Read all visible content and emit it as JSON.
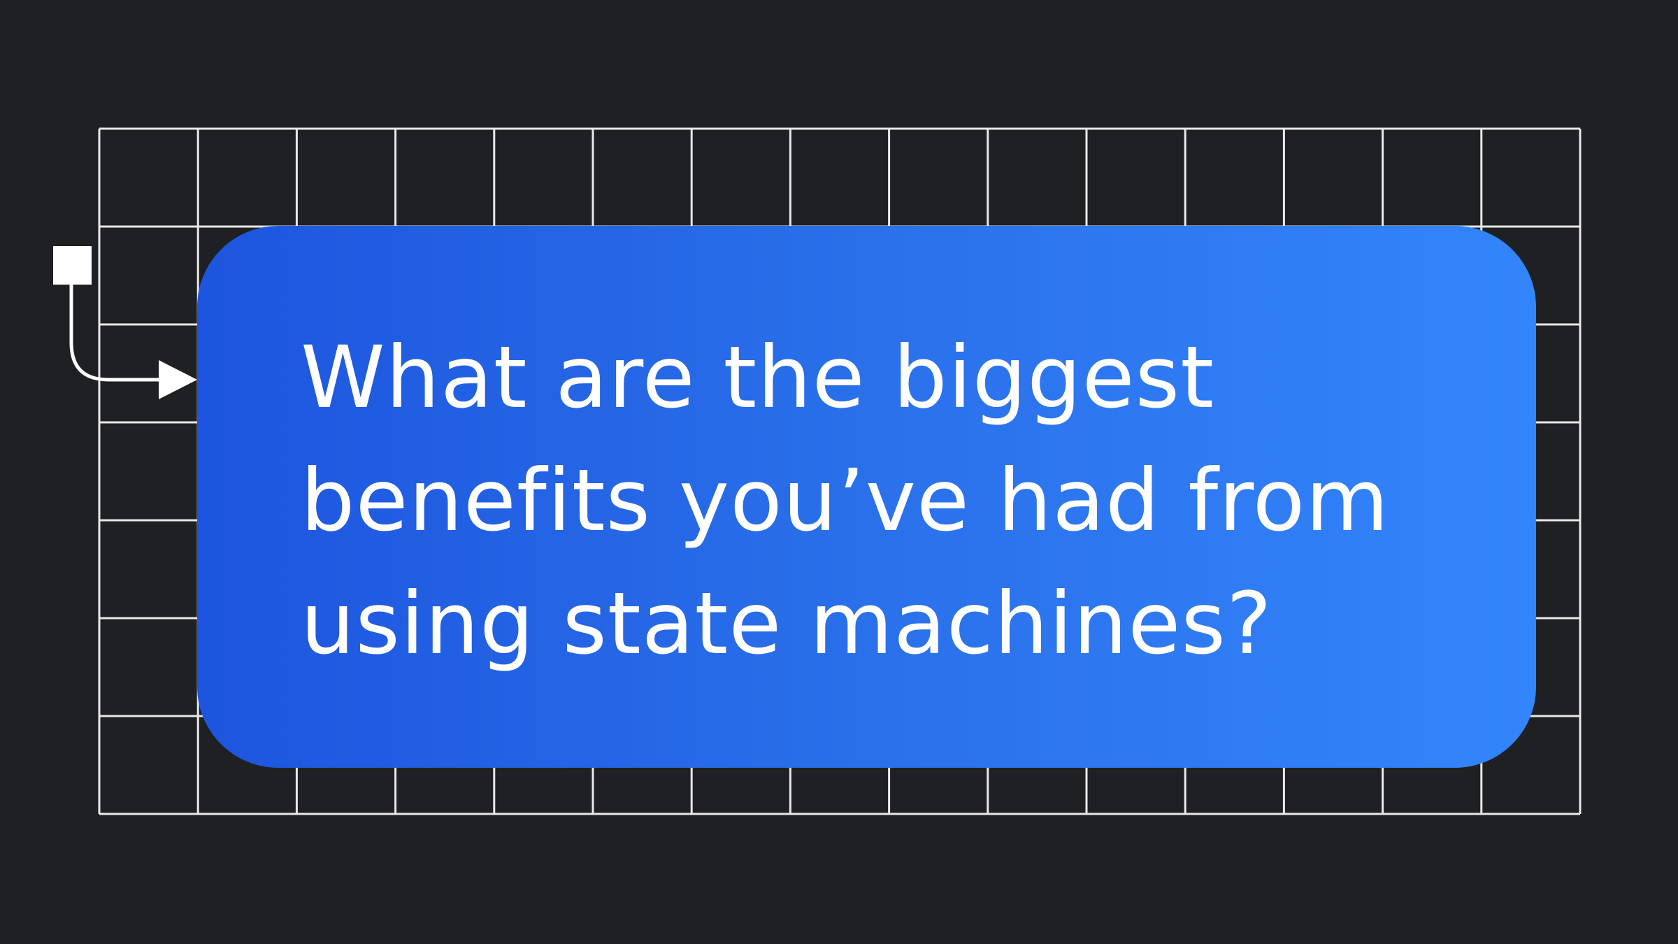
{
  "question": {
    "lines": [
      "What are the biggest",
      "benefits you’ve had from",
      "using state machines?"
    ]
  },
  "icons": {
    "connector": "start-node-arrow-icon"
  },
  "colors": {
    "background": "#1f2024",
    "grid_line": "#e8e8ea",
    "card_gradient_start": "#1d55de",
    "card_gradient_end": "#3385fb",
    "text": "#ffffff"
  }
}
